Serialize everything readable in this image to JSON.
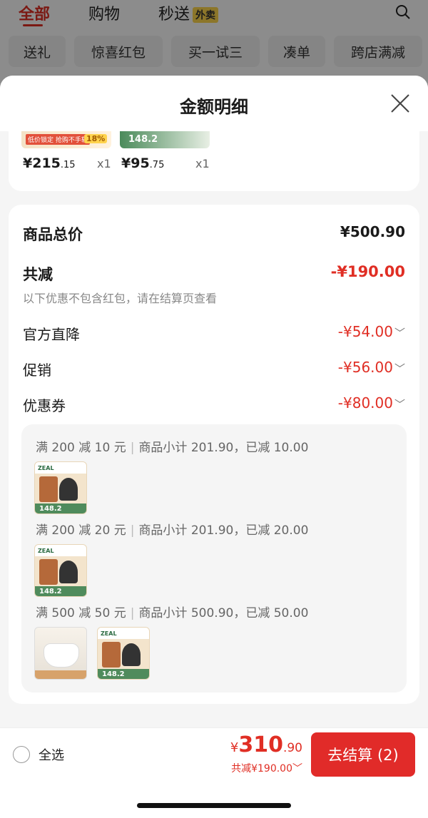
{
  "background": {
    "tabs": [
      {
        "label": "全部",
        "active": true
      },
      {
        "label": "购物",
        "active": false
      },
      {
        "label": "秒送",
        "active": false
      }
    ],
    "waimai_badge": "外卖",
    "chips": [
      "送礼",
      "惊喜红包",
      "买一试三",
      "凑单",
      "跨店满减"
    ]
  },
  "sheet": {
    "title": "金额明细",
    "products": [
      {
        "thumb_tag": "低价锁定 抢购不手软",
        "thumb_pct": "18%",
        "price_main": "¥215",
        "price_dec": ".15",
        "qty": "x1"
      },
      {
        "thumb_num": "148.2",
        "price_main": "¥95",
        "price_dec": ".75",
        "qty": "x1"
      }
    ],
    "detail": {
      "total_label": "商品总价",
      "total_value": "¥500.90",
      "discount_label": "共减",
      "discount_value": "-¥190.00",
      "note": "以下优惠不包含红包，请在结算页查看",
      "rows": [
        {
          "label": "官方直降",
          "value": "-¥54.00"
        },
        {
          "label": "促销",
          "value": "-¥56.00"
        },
        {
          "label": "优惠券",
          "value": "-¥80.00"
        }
      ],
      "chevron": "﹀"
    },
    "coupons": [
      {
        "rule": "满 200 减 10 元",
        "summary": "商品小计 201.90，已减 10.00"
      },
      {
        "rule": "满 200 减 20 元",
        "summary": "商品小计 201.90，已减 20.00"
      },
      {
        "rule": "满 500 减 50 元",
        "summary": "商品小计 500.90，已减 50.00"
      }
    ],
    "thumb_brand": "ZEAL",
    "thumb_num": "148.2"
  },
  "bottom": {
    "select_all": "全选",
    "yen": "¥",
    "total_main": "310",
    "total_dec": ".90",
    "saved": "共减¥190.00",
    "checkout_label": "去结算 (2)"
  }
}
